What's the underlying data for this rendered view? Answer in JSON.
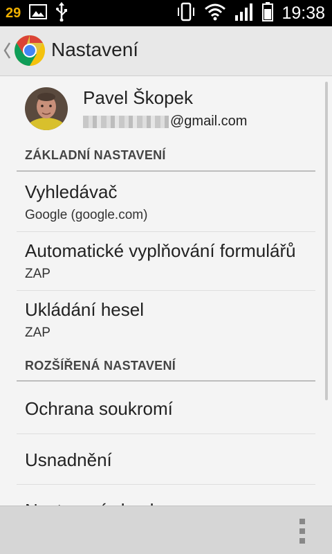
{
  "status_bar": {
    "badge": "29",
    "time": "19:38",
    "icons": [
      "image-icon",
      "usb-icon",
      "phone-vibrate-icon",
      "wifi-icon",
      "signal-icon",
      "battery-icon"
    ]
  },
  "app_bar": {
    "title": "Nastavení",
    "icon": "chrome-logo-icon"
  },
  "account": {
    "name": "Pavel Škopek",
    "email_visible": "@gmail.com"
  },
  "sections": {
    "basic": {
      "header": "ZÁKLADNÍ NASTAVENÍ"
    },
    "advanced": {
      "header": "ROZŠÍŘENÁ NASTAVENÍ"
    }
  },
  "items": {
    "search_engine": {
      "title": "Vyhledávač",
      "value": "Google (google.com)"
    },
    "autofill": {
      "title": "Automatické vyplňování formulářů",
      "value": "ZAP"
    },
    "passwords": {
      "title": "Ukládání hesel",
      "value": "ZAP"
    },
    "privacy": {
      "title": "Ochrana soukromí"
    },
    "accessibility": {
      "title": "Usnadnění"
    },
    "content_settings": {
      "title": "Nastavení obsahu"
    }
  },
  "colors": {
    "status_badge": "#f0b000",
    "app_bar": "#e8e8e8",
    "content_bg": "#f4f4f4",
    "bottom_bar": "#d6d6d6"
  }
}
